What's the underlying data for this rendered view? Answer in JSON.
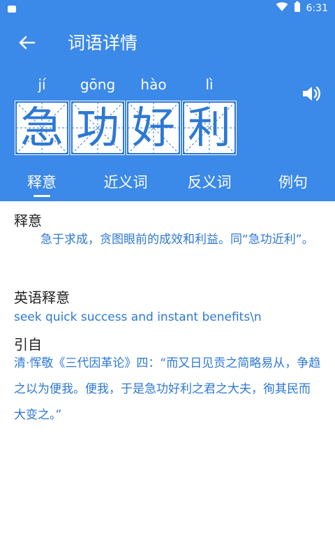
{
  "status": {
    "time": "6:31",
    "colors": {
      "bar": "#3b89e8"
    }
  },
  "app_bar": {
    "title": "词语详情",
    "back_icon": "arrow-left-icon"
  },
  "word": {
    "pinyin": [
      "jí",
      "gōng",
      "hào",
      "lì"
    ],
    "characters": [
      "急",
      "功",
      "好",
      "利"
    ],
    "speaker_icon": "speaker-volume-icon"
  },
  "tabs": [
    {
      "label": "释意"
    },
    {
      "label": "近义词"
    },
    {
      "label": "反义词"
    },
    {
      "label": "例句"
    }
  ],
  "sections": {
    "meaning": {
      "title": "释意",
      "text": "急于求成，贪图眼前的成效和利益。同“急功近利”。"
    },
    "english": {
      "title": "英语释意",
      "text": "seek quick success and instant benefits\\n"
    },
    "source": {
      "title": "引自",
      "text": "清·恽敬《三代因革论》四：“而又日见贡之简略易从，争趋之以为便我。便我，于是急功好利之君之大夫，徇其民而大变之。”"
    }
  },
  "colors": {
    "accent": "#3b89e8",
    "link_text": "#2d78d4"
  }
}
